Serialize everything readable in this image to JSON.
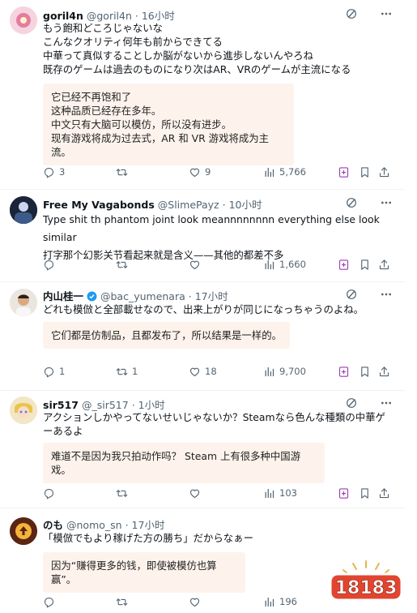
{
  "tweets": [
    {
      "name": "goril4n",
      "handle": "@goril4n",
      "time": "16小时",
      "text": "もう飽和どころじゃないな\nこんなクオリティ何年も前からできてる\n中華って真似することしか脳がないから進歩しないんやろね\n既存のゲームは過去のものになり次はAR、VRのゲームが主流になる",
      "translation": "它已经不再饱和了\n这种品质已经存在多年。\n中文只有大脑可以模仿，所以没有进步。\n现有游戏将成为过去式，AR 和 VR 游戏将成为主流。",
      "replies": "3",
      "reposts": "",
      "likes": "9",
      "views": "5,766"
    },
    {
      "name": "Free My Vagabonds",
      "handle": "@SlimePayz",
      "time": "10小时",
      "text": "Type shit th phantom joint look meannnnnnnn everything else  look similar\n打字那个幻影关节看起来就是含义——其他的都差不多",
      "translation": "",
      "replies": "",
      "reposts": "",
      "likes": "",
      "views": "1,660"
    },
    {
      "name": "内山桂一",
      "handle": "@bac_yumenara",
      "time": "17小时",
      "text": "どれも模倣と全部載せなので、出来上がりが同じになっちゃうのよね。",
      "translation": "它们都是仿制品，且都发布了，所以结果是一样的。",
      "replies": "1",
      "reposts": "1",
      "likes": "18",
      "views": "9,700"
    },
    {
      "name": "sir517",
      "handle": "@_sir517",
      "time": "1小时",
      "text": "アクションしかやってないせいじゃないか？Steamなら色んな種類の中華ゲーあるよ",
      "translation": "难道不是因为我只拍动作吗？ Steam 上有很多种中国游戏。",
      "replies": "",
      "reposts": "",
      "likes": "",
      "views": "103"
    },
    {
      "name": "のも",
      "handle": "@nomo_sn",
      "time": "17小时",
      "text": "「模倣でもより稼げた方の勝ち」だからなぁー",
      "translation": "因为“赚得更多的钱，即使被模仿也算赢”。",
      "replies": "",
      "reposts": "",
      "likes": "",
      "views": "196"
    }
  ],
  "sep": "·",
  "watermark": "18183"
}
